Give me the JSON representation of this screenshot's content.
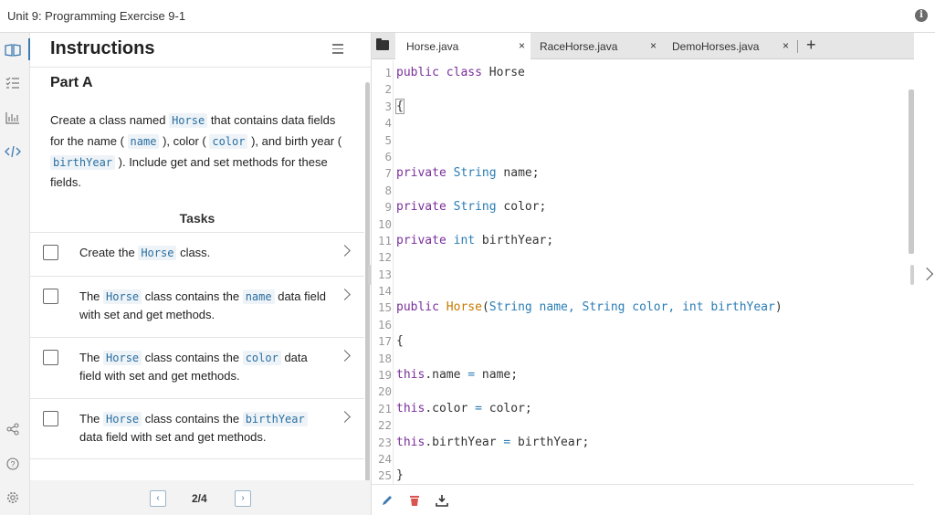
{
  "topbar": {
    "title": "Unit 9: Programming Exercise 9-1",
    "info_icon": "info-icon"
  },
  "rail": {
    "icons": [
      "book-icon",
      "checklist-icon",
      "chart-icon",
      "code-icon",
      "share-icon",
      "help-icon",
      "settings-icon"
    ]
  },
  "instructions": {
    "heading": "Instructions",
    "part_title": "Part A",
    "description": {
      "t1": "Create a class named ",
      "c1": "Horse",
      "t2": " that contains data fields for the name ( ",
      "c2": "name",
      "t3": " ), color ( ",
      "c3": "color",
      "t4": " ), and birth year ( ",
      "c4": "birthYear",
      "t5": " ). Include get and set methods for these fields."
    },
    "tasks_title": "Tasks",
    "tasks": [
      {
        "t1": "Create the ",
        "c1": "Horse",
        "t2": " class.",
        "c2": "",
        "t3": ""
      },
      {
        "t1": "The ",
        "c1": "Horse",
        "t2": " class contains the ",
        "c2": "name",
        "t3": " data field with set and get methods."
      },
      {
        "t1": "The ",
        "c1": "Horse",
        "t2": " class contains the ",
        "c2": "color",
        "t3": " data field with set and get methods."
      },
      {
        "t1": "The ",
        "c1": "Horse",
        "t2": " class contains the ",
        "c2": "birthYear",
        "t3": " data field with set and get methods."
      }
    ],
    "pager": {
      "prev": "‹",
      "page": "2/4",
      "next": "›"
    }
  },
  "editor": {
    "tabs": [
      {
        "label": "Horse.java",
        "active": true
      },
      {
        "label": "RaceHorse.java",
        "active": false
      },
      {
        "label": "DemoHorses.java",
        "active": false
      }
    ],
    "tab_close": "×",
    "tab_add": "+",
    "line_numbers": [
      "1",
      "2",
      "3",
      "4",
      "5",
      "6",
      "7",
      "8",
      "9",
      "10",
      "11",
      "12",
      "13",
      "14",
      "15",
      "16",
      "17",
      "18",
      "19",
      "20",
      "21",
      "22",
      "23",
      "24",
      "25"
    ],
    "code": {
      "l1_kw": "public class",
      "l1_name": " Horse",
      "l3": "{",
      "l7_kw": "private",
      "l7_ty": " String",
      "l7_rest": " name;",
      "l9_kw": "private",
      "l9_ty": " String",
      "l9_rest": " color;",
      "l11_kw": "private",
      "l11_ty": " int",
      "l11_rest": " birthYear;",
      "l15_kw": "public",
      "l15_fn": " Horse",
      "l15_a": "(",
      "l15_t1": "String name, String color, int birthYear",
      "l15_b": ")",
      "l17": "{",
      "l19_kw": "this",
      "l19_rest": ".name ",
      "l19_op": "=",
      "l19_end": " name;",
      "l21_kw": "this",
      "l21_rest": ".color ",
      "l21_op": "=",
      "l21_end": " color;",
      "l23_kw": "this",
      "l23_rest": ".birthYear ",
      "l23_op": "=",
      "l23_end": " birthYear;",
      "l25": "}"
    },
    "footer_icons": [
      "pencil-icon",
      "trash-icon",
      "download-icon"
    ]
  },
  "colors": {
    "keyword": "#7a2f9a",
    "type": "#2a7db5",
    "function": "#c47a00",
    "accent": "#4a7aa6"
  }
}
